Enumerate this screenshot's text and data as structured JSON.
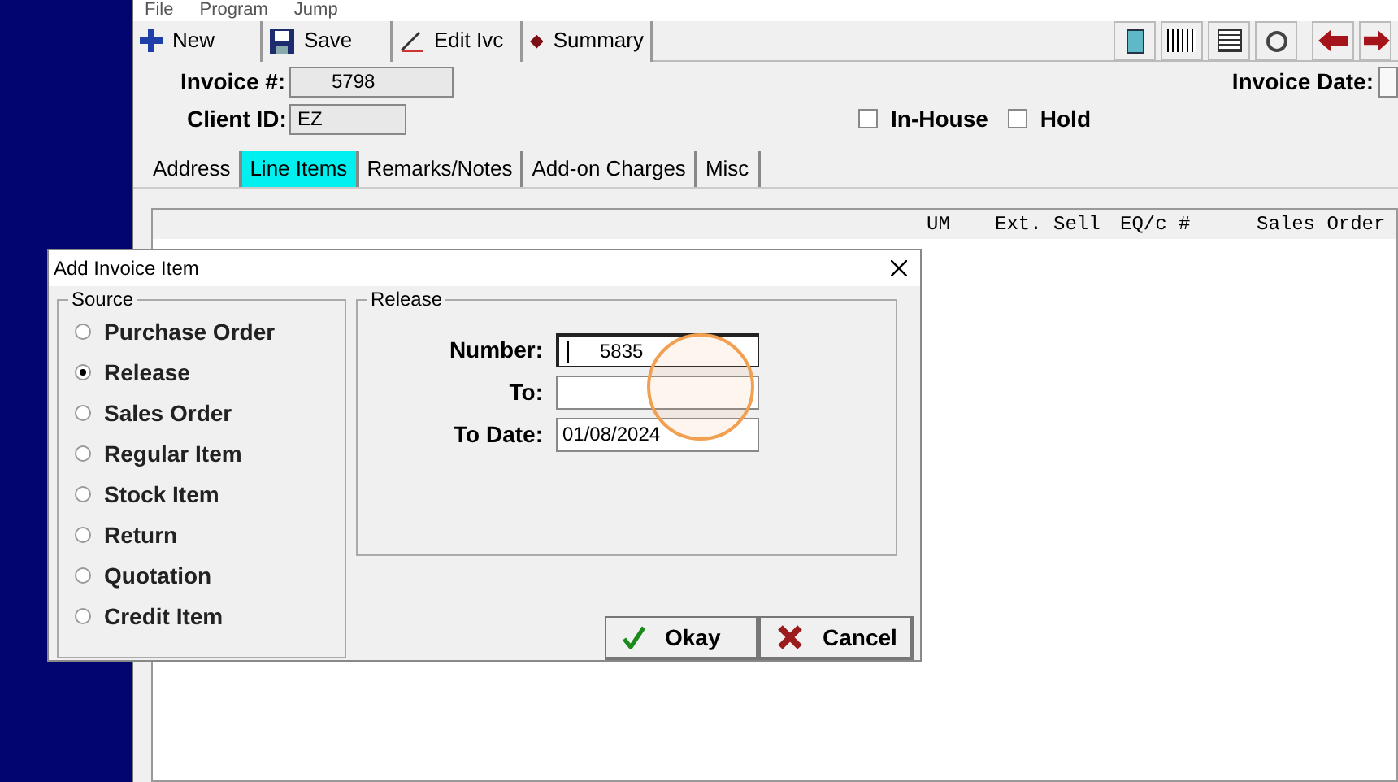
{
  "menu": [
    "File",
    "Program",
    "Jump"
  ],
  "toolbar": [
    {
      "kind": "new",
      "label": "New"
    },
    {
      "kind": "save",
      "label": "Save"
    },
    {
      "kind": "edit",
      "label": "Edit Ivc"
    },
    {
      "kind": "summary",
      "label": "Summary"
    }
  ],
  "header": {
    "invoice_label": "Invoice #:",
    "invoice_value": "5798",
    "client_label": "Client ID:",
    "client_value": "EZ",
    "invoice_date_label": "Invoice Date:",
    "checks": [
      {
        "label": "In-House",
        "checked": false
      },
      {
        "label": "Hold",
        "checked": false
      }
    ]
  },
  "tabs": [
    {
      "label": "Address",
      "selected": false
    },
    {
      "label": "Line Items",
      "selected": true
    },
    {
      "label": "Remarks/Notes",
      "selected": false
    },
    {
      "label": "Add-on Charges",
      "selected": false
    },
    {
      "label": "Misc",
      "selected": false
    }
  ],
  "table": {
    "columns": [
      "UM",
      "Ext. Sell",
      "EQ/c #",
      "Sales Order"
    ]
  },
  "dialog": {
    "title": "Add Invoice Item",
    "source": {
      "title": "Source",
      "options": [
        {
          "label": "Purchase Order",
          "selected": false
        },
        {
          "label": "Release",
          "selected": true
        },
        {
          "label": "Sales Order",
          "selected": false
        },
        {
          "label": "Regular Item",
          "selected": false
        },
        {
          "label": "Stock Item",
          "selected": false
        },
        {
          "label": "Return",
          "selected": false
        },
        {
          "label": "Quotation",
          "selected": false
        },
        {
          "label": "Credit Item",
          "selected": false
        }
      ]
    },
    "release": {
      "title": "Release",
      "fields": [
        {
          "label": "Number:",
          "value": "5835",
          "focused": true
        },
        {
          "label": "To:",
          "focused": false
        },
        {
          "label": "To Date:",
          "value": "01/08/2024",
          "focused": false
        }
      ]
    },
    "buttons": [
      {
        "kind": "ok",
        "label": "Okay"
      },
      {
        "kind": "cancel",
        "label": "Cancel"
      }
    ]
  }
}
